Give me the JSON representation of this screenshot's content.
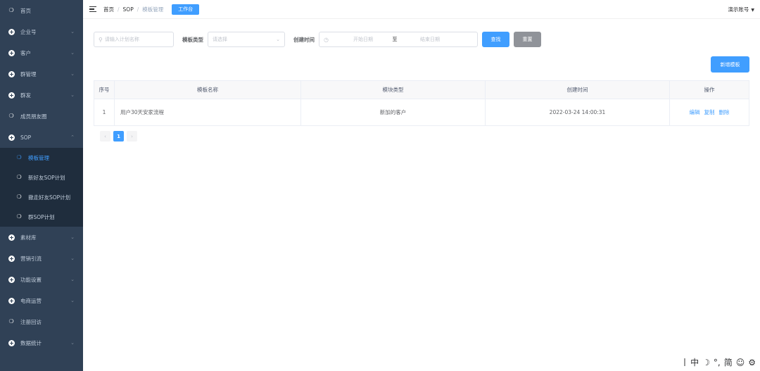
{
  "sidebar": {
    "items": [
      {
        "label": "首页",
        "icon": "group-icon",
        "has_children": false
      },
      {
        "label": "企业号",
        "icon": "plus-circle-icon",
        "has_children": true
      },
      {
        "label": "客户",
        "icon": "plus-circle-icon",
        "has_children": true
      },
      {
        "label": "群管理",
        "icon": "plus-circle-icon",
        "has_children": true
      },
      {
        "label": "群发",
        "icon": "plus-circle-icon",
        "has_children": true
      },
      {
        "label": "成员朋友圈",
        "icon": "group-icon",
        "has_children": false
      },
      {
        "label": "SOP",
        "icon": "plus-circle-icon",
        "has_children": true,
        "expanded": true
      }
    ],
    "sop_children": [
      {
        "label": "模板管理",
        "active": true
      },
      {
        "label": "新好友SOP计划",
        "active": false
      },
      {
        "label": "撤走好友SOP计划",
        "active": false
      },
      {
        "label": "群SOP计划",
        "active": false
      }
    ],
    "items_after": [
      {
        "label": "素材库",
        "icon": "plus-circle-icon",
        "has_children": true
      },
      {
        "label": "营销引流",
        "icon": "plus-circle-icon",
        "has_children": true
      },
      {
        "label": "功能设置",
        "icon": "plus-circle-icon",
        "has_children": true
      },
      {
        "label": "电商运营",
        "icon": "plus-circle-icon",
        "has_children": true
      },
      {
        "label": "注册回访",
        "icon": "group-icon",
        "has_children": false
      },
      {
        "label": "数据统计",
        "icon": "plus-circle-icon",
        "has_children": true
      }
    ]
  },
  "header": {
    "breadcrumb": [
      "首页",
      "SOP",
      "模板管理"
    ],
    "workbench_label": "工作台",
    "account_label": "演示账号"
  },
  "filters": {
    "search_placeholder": "请输入计划名称",
    "type_label": "模板类型",
    "type_placeholder": "请选择",
    "created_label": "创建时间",
    "start_placeholder": "开始日期",
    "range_sep": "至",
    "end_placeholder": "结束日期",
    "search_btn": "查找",
    "reset_btn": "重置"
  },
  "add_btn": "新增模板",
  "table": {
    "headers": [
      "序号",
      "模板名称",
      "模块类型",
      "创建时间",
      "操作"
    ],
    "rows": [
      {
        "index": "1",
        "name": "用户30天安家流程",
        "type": "新加的客户",
        "created": "2022-03-24 14:00:31"
      }
    ],
    "actions": [
      "编辑",
      "复制",
      "删除"
    ]
  },
  "pagination": {
    "prev": "‹",
    "current": "1",
    "next": "›"
  },
  "ime": {
    "chinese": "中",
    "moon": "☽",
    "punct": "°,",
    "simplified": "简",
    "emoji": "☺",
    "settings": "⚙"
  },
  "colors": {
    "sidebar_bg": "#304156",
    "submenu_bg": "#1f2d3d",
    "primary": "#409eff",
    "gray_btn": "#909399"
  }
}
